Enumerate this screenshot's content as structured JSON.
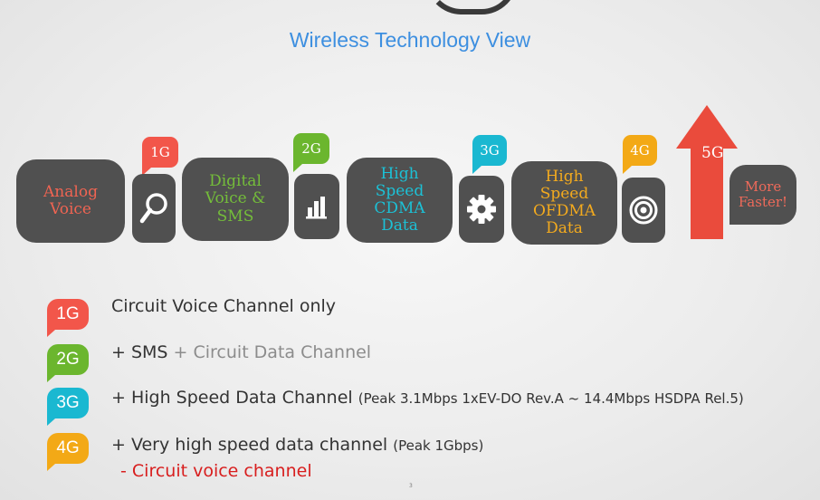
{
  "subtitle": "Wireless Technology View",
  "colors": {
    "1g": "#f2564a",
    "2g": "#6bb62e",
    "3g": "#1ab8d1",
    "4g": "#f3a916",
    "5g": "#ea4b3c",
    "box": "#505050"
  },
  "timeline": {
    "analog": "Analog Voice",
    "g1": {
      "tag": "1G",
      "icon": "magnifier-icon"
    },
    "digital": "Digital Voice & SMS",
    "g2": {
      "tag": "2G",
      "icon": "bar-chart-icon"
    },
    "cdma": "High Speed CDMA Data",
    "g3": {
      "tag": "3G",
      "icon": "gear-icon"
    },
    "ofdma": "High Speed OFDMA Data",
    "g4": {
      "tag": "4G",
      "icon": "target-icon"
    },
    "g5": {
      "tag": "5G",
      "text": "More Faster!"
    }
  },
  "legend": {
    "g1": {
      "tag": "1G",
      "text": "Circuit Voice Channel only"
    },
    "g2": {
      "tag": "2G",
      "text1": "+ SMS",
      "text2": " + Circuit Data Channel"
    },
    "g3": {
      "tag": "3G",
      "text1": "+ High Speed Data Channel ",
      "note": "(Peak 3.1Mbps 1xEV-DO Rev.A ~ 14.4Mbps HSDPA Rel.5)"
    },
    "g4": {
      "tag": "4G",
      "text1": "+ Very high speed data channel ",
      "note": "(Peak 1Gbps)",
      "text2": "- Circuit voice channel"
    }
  },
  "page_number": "3"
}
